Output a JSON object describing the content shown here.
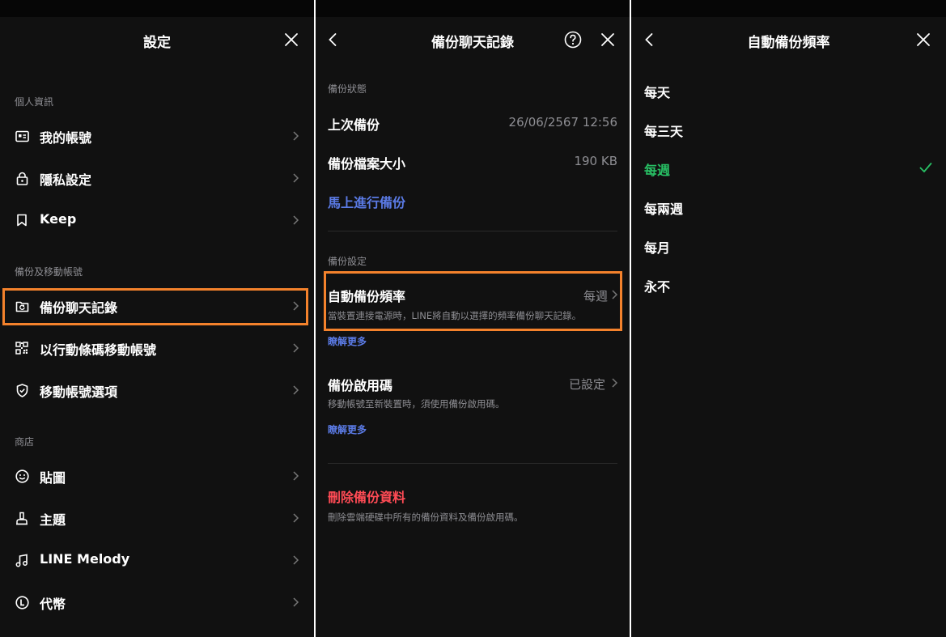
{
  "colors": {
    "background": "#111111",
    "accent_highlight": "#f4822c",
    "link": "#5b7be6",
    "danger": "#ff4b55",
    "selected": "#28c165",
    "muted": "#8e8e93"
  },
  "settings": {
    "title": "設定",
    "sections": [
      {
        "header": "個人資訊",
        "items": [
          {
            "label": "我的帳號",
            "icon": "id-card-icon"
          },
          {
            "label": "隱私設定",
            "icon": "lock-icon"
          },
          {
            "label": "Keep",
            "icon": "bookmark-icon"
          }
        ]
      },
      {
        "header": "備份及移動帳號",
        "items": [
          {
            "label": "備份聊天記錄",
            "icon": "backup-icon"
          },
          {
            "label": "以行動條碼移動帳號",
            "icon": "qr-code-icon"
          },
          {
            "label": "移動帳號選項",
            "icon": "shield-icon"
          }
        ]
      },
      {
        "header": "商店",
        "items": [
          {
            "label": "貼圖",
            "icon": "smile-icon"
          },
          {
            "label": "主題",
            "icon": "theme-brush-icon"
          },
          {
            "label": "LINE Melody",
            "icon": "music-note-icon"
          },
          {
            "label": "代幣",
            "icon": "coin-icon"
          }
        ]
      }
    ]
  },
  "backup": {
    "title": "備份聊天記錄",
    "status_header": "備份狀態",
    "last_backup_label": "上次備份",
    "last_backup_value": "26/06/2567 12:56",
    "size_label": "備份檔案大小",
    "size_value": "190 KB",
    "backup_now": "馬上進行備份",
    "settings_header": "備份設定",
    "frequency_label": "自動備份頻率",
    "frequency_value": "每週",
    "frequency_desc": "當裝置連接電源時，LINE將自動以選擇的頻率備份聊天記錄。",
    "learn_more": "瞭解更多",
    "pin_label": "備份啟用碼",
    "pin_value": "已設定",
    "pin_desc": "移動帳號至新裝置時，須使用備份啟用碼。",
    "delete_label": "刪除備份資料",
    "delete_desc": "刪除雲端硬碟中所有的備份資料及備份啟用碼。"
  },
  "frequency": {
    "title": "自動備份頻率",
    "options": [
      "每天",
      "每三天",
      "每週",
      "每兩週",
      "每月",
      "永不"
    ],
    "selected_index": 2
  }
}
